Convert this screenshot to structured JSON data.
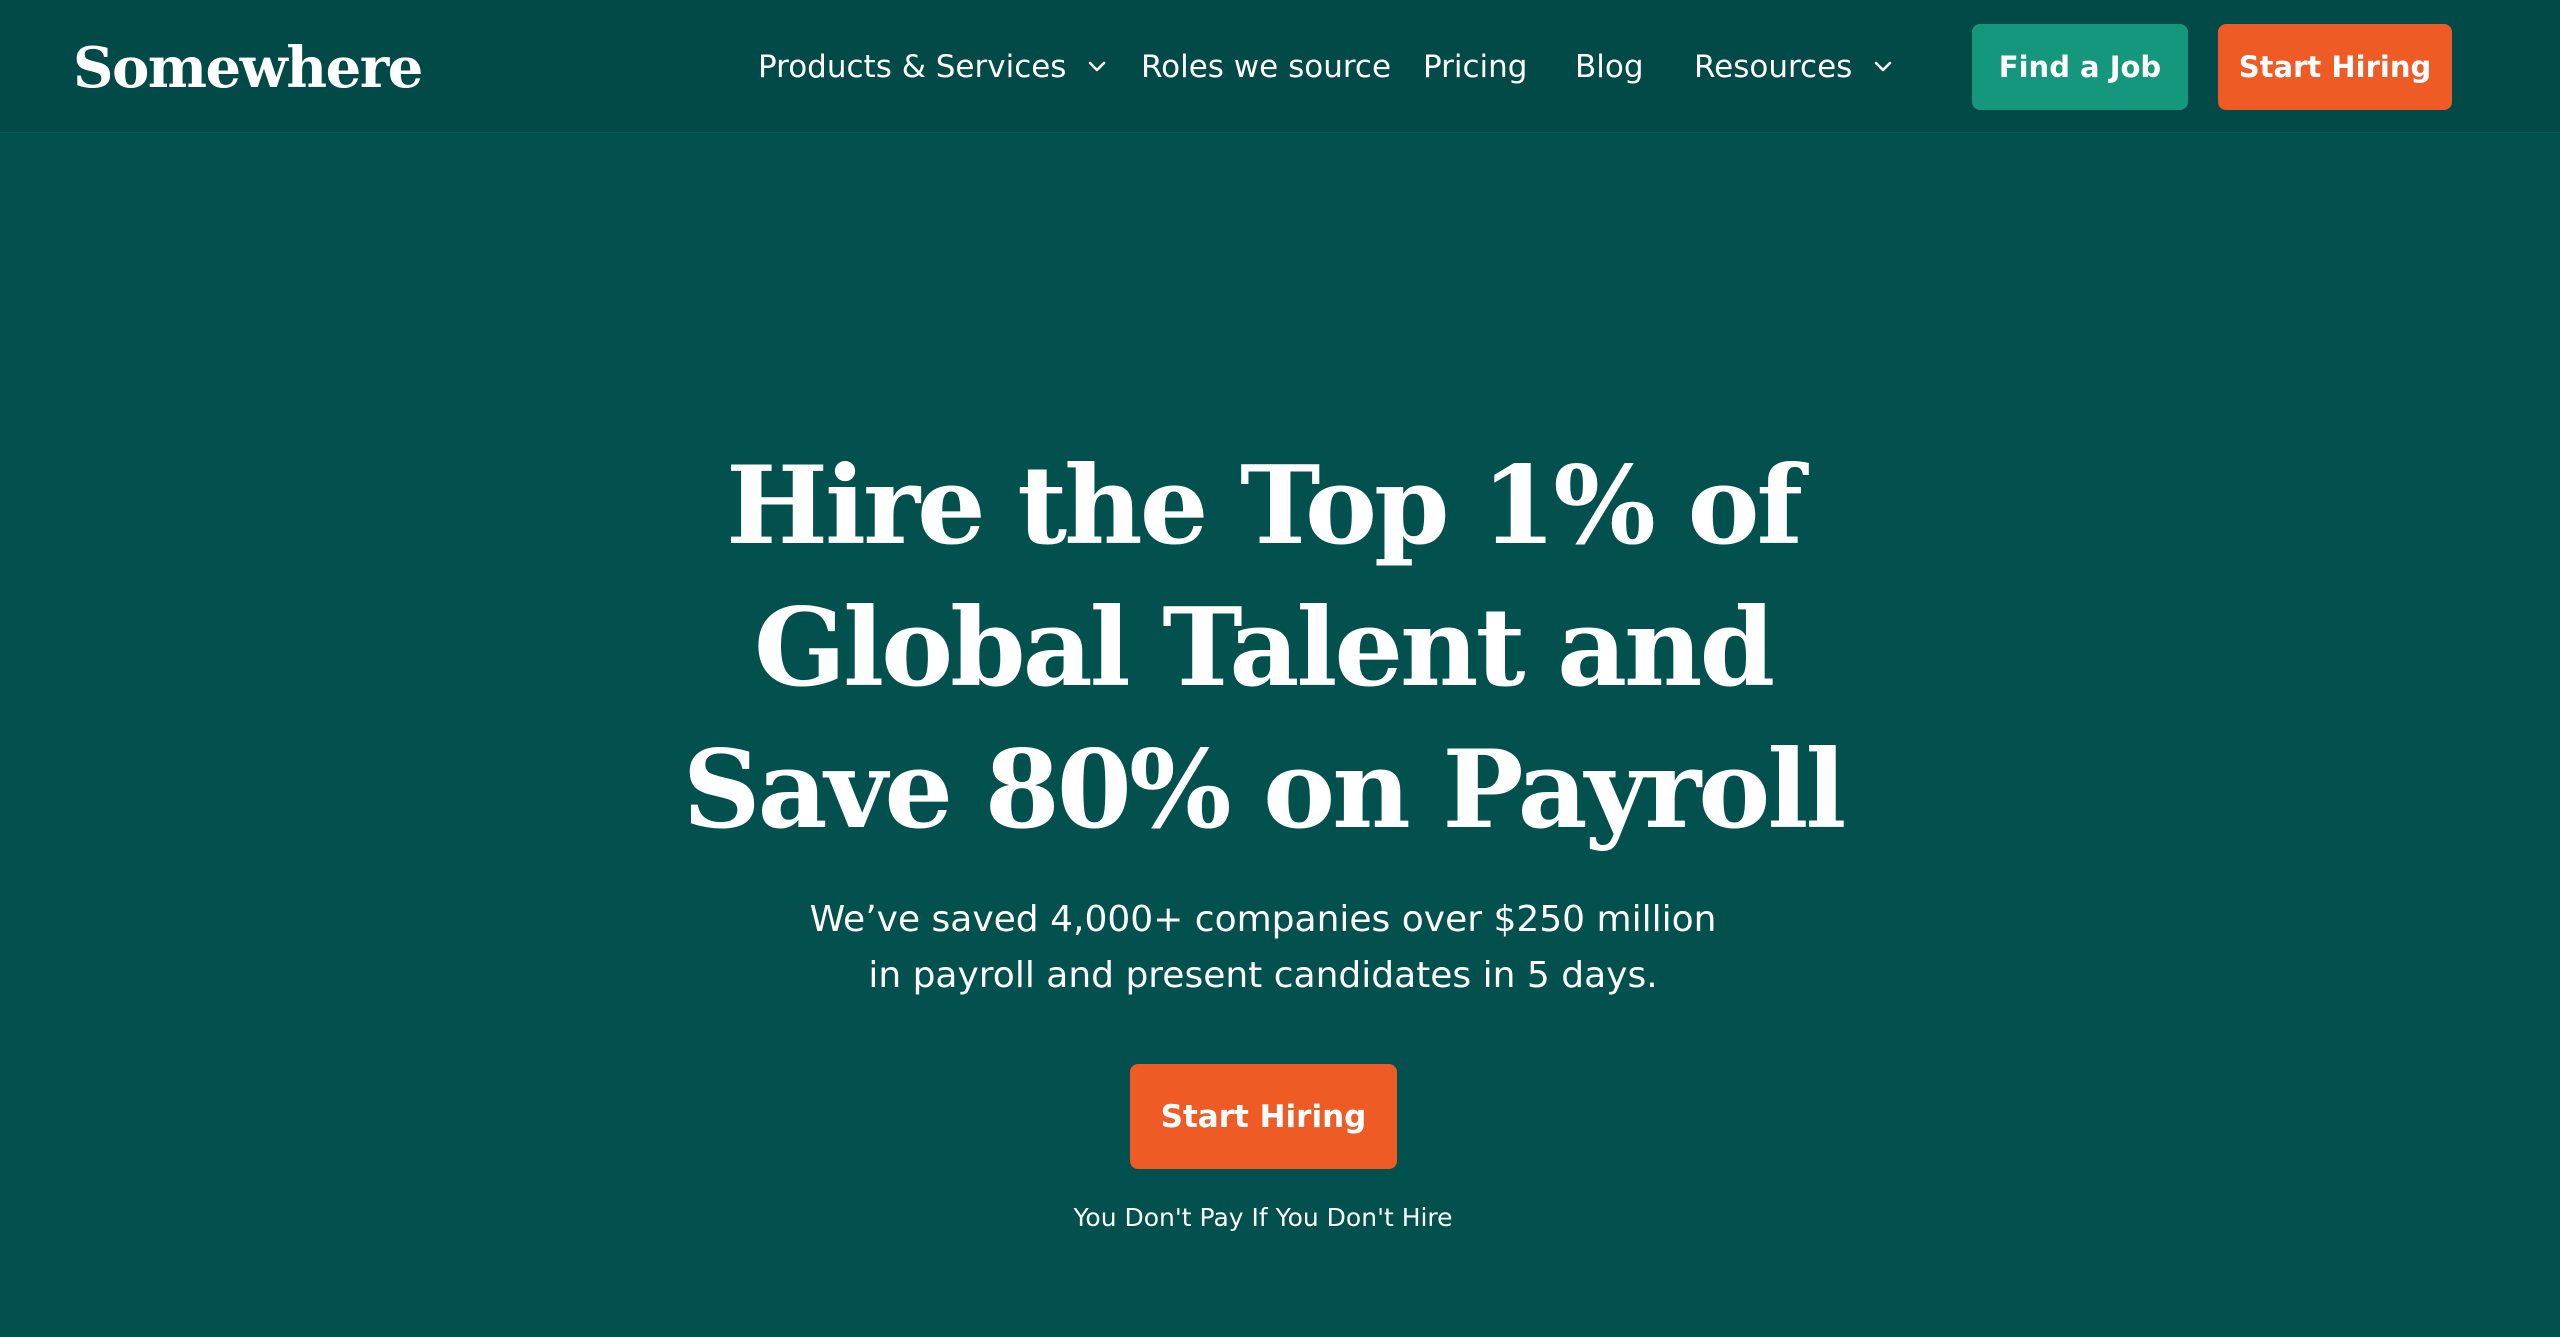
{
  "header": {
    "logo": "Somewhere",
    "nav": {
      "products": "Products & Services",
      "roles": "Roles we source",
      "pricing": "Pricing",
      "blog": "Blog",
      "resources": "Resources"
    },
    "find_job_label": "Find a Job",
    "start_hiring_label": "Start Hiring"
  },
  "hero": {
    "title_lines": [
      "Hire the Top 1% of",
      "Global Talent and",
      "Save 80% on Payroll"
    ],
    "subtitle_lines": [
      "We’ve saved 4,000+ companies over $250 million",
      "in payroll and present candidates in 5 days."
    ],
    "cta_label": "Start Hiring",
    "note": "You Don't Pay If You Don't Hire"
  },
  "colors": {
    "background": "#02514f",
    "header_background": "#024a48",
    "find_job_button": "#14977c",
    "start_hiring_button": "#ef5b25",
    "text": "#ffffff"
  },
  "icons": {
    "products_dropdown": "chevron-down-icon",
    "resources_dropdown": "chevron-down-icon"
  }
}
